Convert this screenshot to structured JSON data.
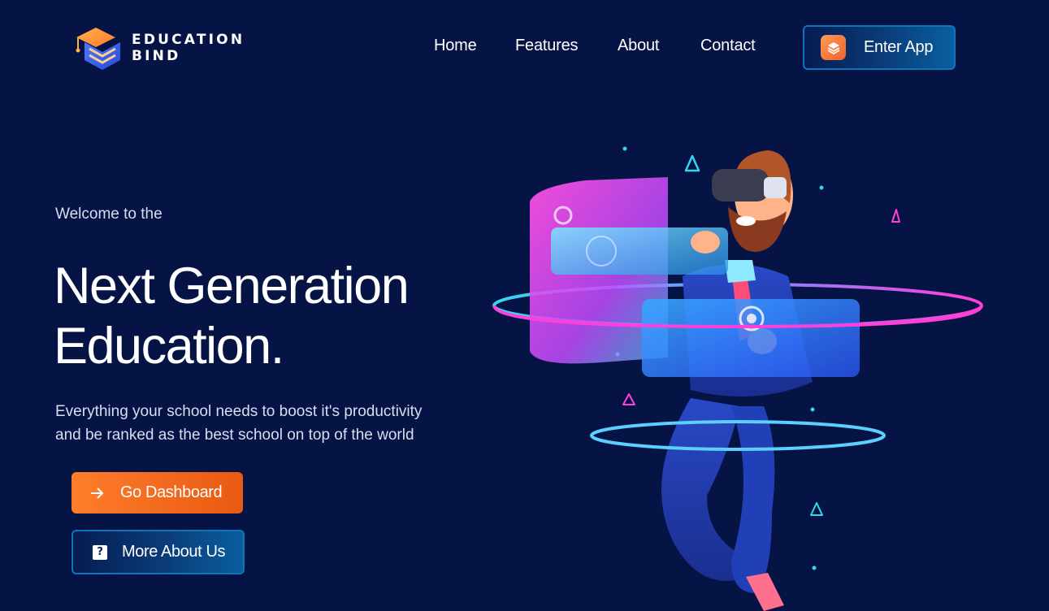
{
  "brand": {
    "line1": "EDUCATION",
    "line2": "BIND",
    "icon": "graduation-cap-logo-icon"
  },
  "nav": {
    "items": [
      {
        "label": "Home"
      },
      {
        "label": "Features"
      },
      {
        "label": "About"
      },
      {
        "label": "Contact"
      }
    ],
    "cta": {
      "label": "Enter App",
      "icon": "layers-icon"
    }
  },
  "hero": {
    "welcome": "Welcome to the",
    "headline_line1": "Next Generation",
    "headline_line2": "Education.",
    "subtext_line1": "Everything your school needs to boost it's productivity",
    "subtext_line2": "and be ranked as the best school on top of the world",
    "primary_button": {
      "label": "Go Dashboard",
      "icon": "arrow-right-icon"
    },
    "secondary_button": {
      "label": "More About Us",
      "icon": "question-icon"
    },
    "illustration": "vr-person-floating-screens-illustration"
  },
  "colors": {
    "background": "#061445",
    "accent_orange": "#f0622a",
    "accent_blue": "#0f74b8",
    "accent_pink": "#ff3fd8",
    "accent_cyan": "#35d7f0"
  }
}
